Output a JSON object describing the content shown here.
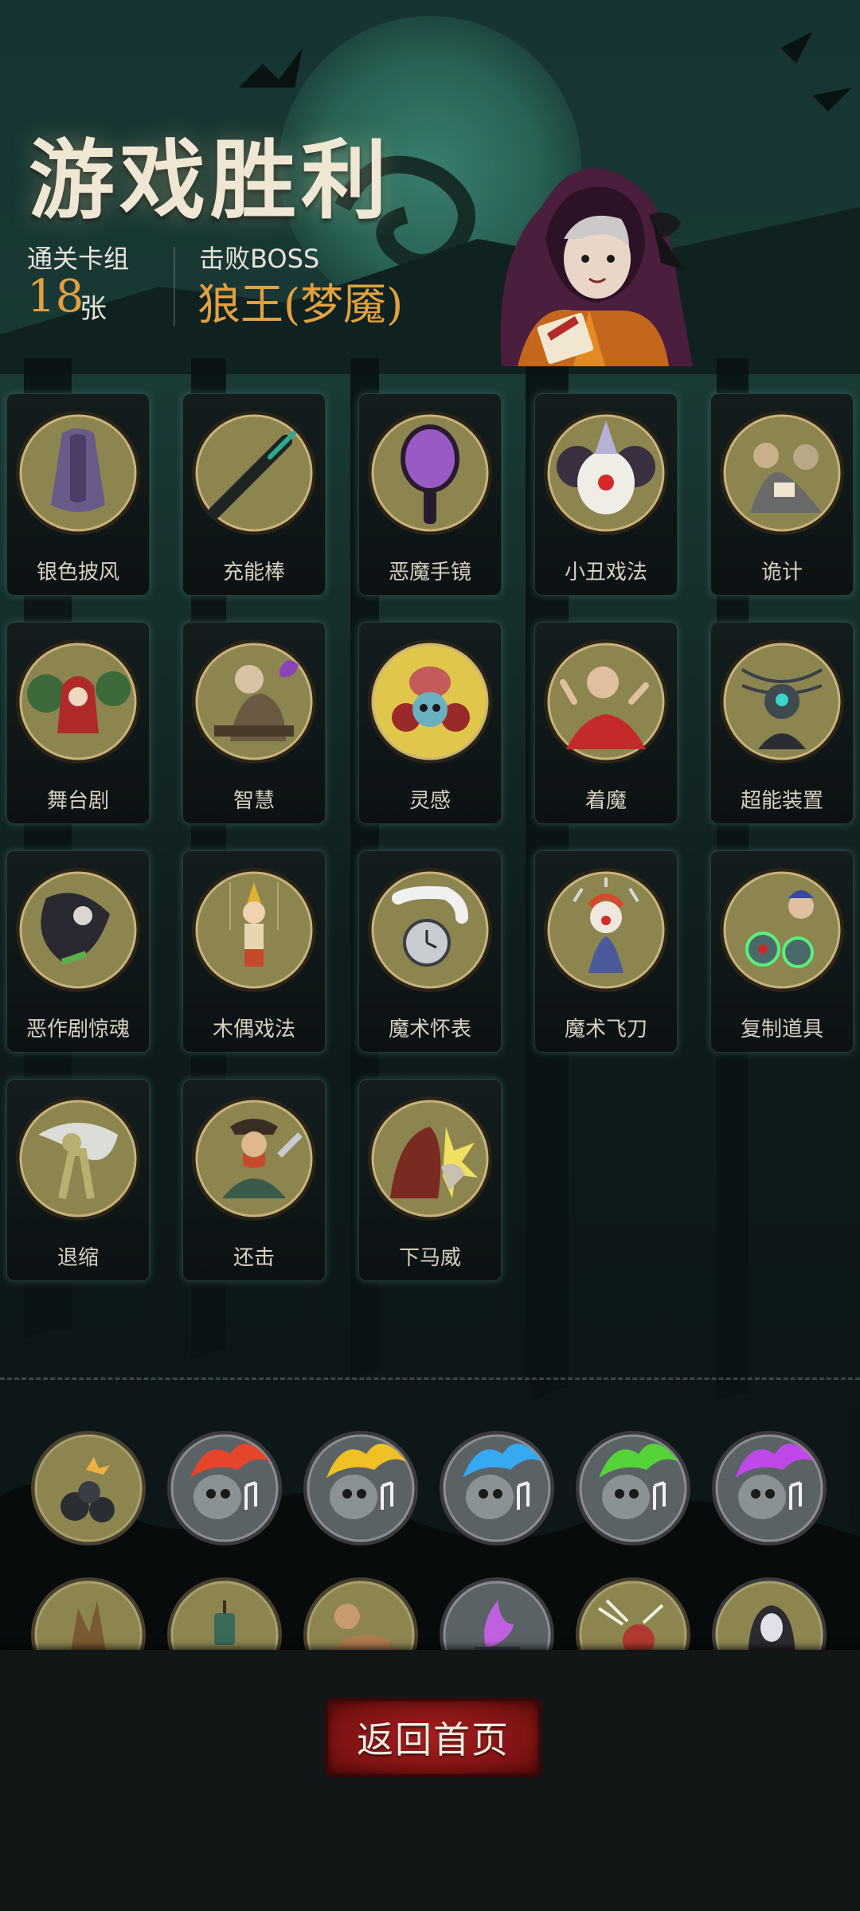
{
  "header": {
    "title": "游戏胜利",
    "levels_label": "通关卡组",
    "levels_value": "18",
    "levels_unit": "张",
    "boss_label": "击败BOSS",
    "boss_name": "狼王(梦魇)"
  },
  "cards": [
    {
      "name": "银色披风",
      "icon": "cloak-icon"
    },
    {
      "name": "充能棒",
      "icon": "wand-icon"
    },
    {
      "name": "恶魔手镜",
      "icon": "hand-mirror-icon"
    },
    {
      "name": "小丑戏法",
      "icon": "clown-icon"
    },
    {
      "name": "诡计",
      "icon": "card-players-icon"
    },
    {
      "name": "舞台剧",
      "icon": "stage-play-icon"
    },
    {
      "name": "智慧",
      "icon": "old-scholar-icon"
    },
    {
      "name": "灵感",
      "icon": "brain-skull-icon"
    },
    {
      "name": "着魔",
      "icon": "possessed-man-icon"
    },
    {
      "name": "超能装置",
      "icon": "psychic-device-icon"
    },
    {
      "name": "恶作剧惊魂",
      "icon": "prank-witch-icon"
    },
    {
      "name": "木偶戏法",
      "icon": "puppet-icon"
    },
    {
      "name": "魔术怀表",
      "icon": "pocket-watch-icon"
    },
    {
      "name": "魔术飞刀",
      "icon": "juggling-clown-icon"
    },
    {
      "name": "复制道具",
      "icon": "magician-copy-icon"
    },
    {
      "name": "退缩",
      "icon": "retreat-figure-icon"
    },
    {
      "name": "还击",
      "icon": "pirate-counter-icon"
    },
    {
      "name": "下马威",
      "icon": "intimidate-beast-icon"
    }
  ],
  "bonus_row_1": [
    {
      "icon": "bomb-pile-icon"
    },
    {
      "icon": "fire-music-skull-icon",
      "color": "#e5452a"
    },
    {
      "icon": "fire-music-skull-icon",
      "color": "#f0c024"
    },
    {
      "icon": "fire-music-skull-icon",
      "color": "#37a8f2"
    },
    {
      "icon": "fire-music-skull-icon",
      "color": "#55d43a"
    },
    {
      "icon": "fire-music-skull-icon",
      "color": "#c048e8"
    }
  ],
  "bonus_row_2": [
    {
      "icon": "tree-creature-icon"
    },
    {
      "icon": "lantern-icon"
    },
    {
      "icon": "muscle-man-icon"
    },
    {
      "icon": "purple-flame-icon"
    },
    {
      "icon": "shout-girl-icon"
    },
    {
      "icon": "masked-figure-icon"
    }
  ],
  "footer": {
    "home_button": "返回首页"
  },
  "colors": {
    "accent_gold": "#e3a040",
    "button_red": "#8c1818",
    "disc_olive": "#8c8550"
  }
}
